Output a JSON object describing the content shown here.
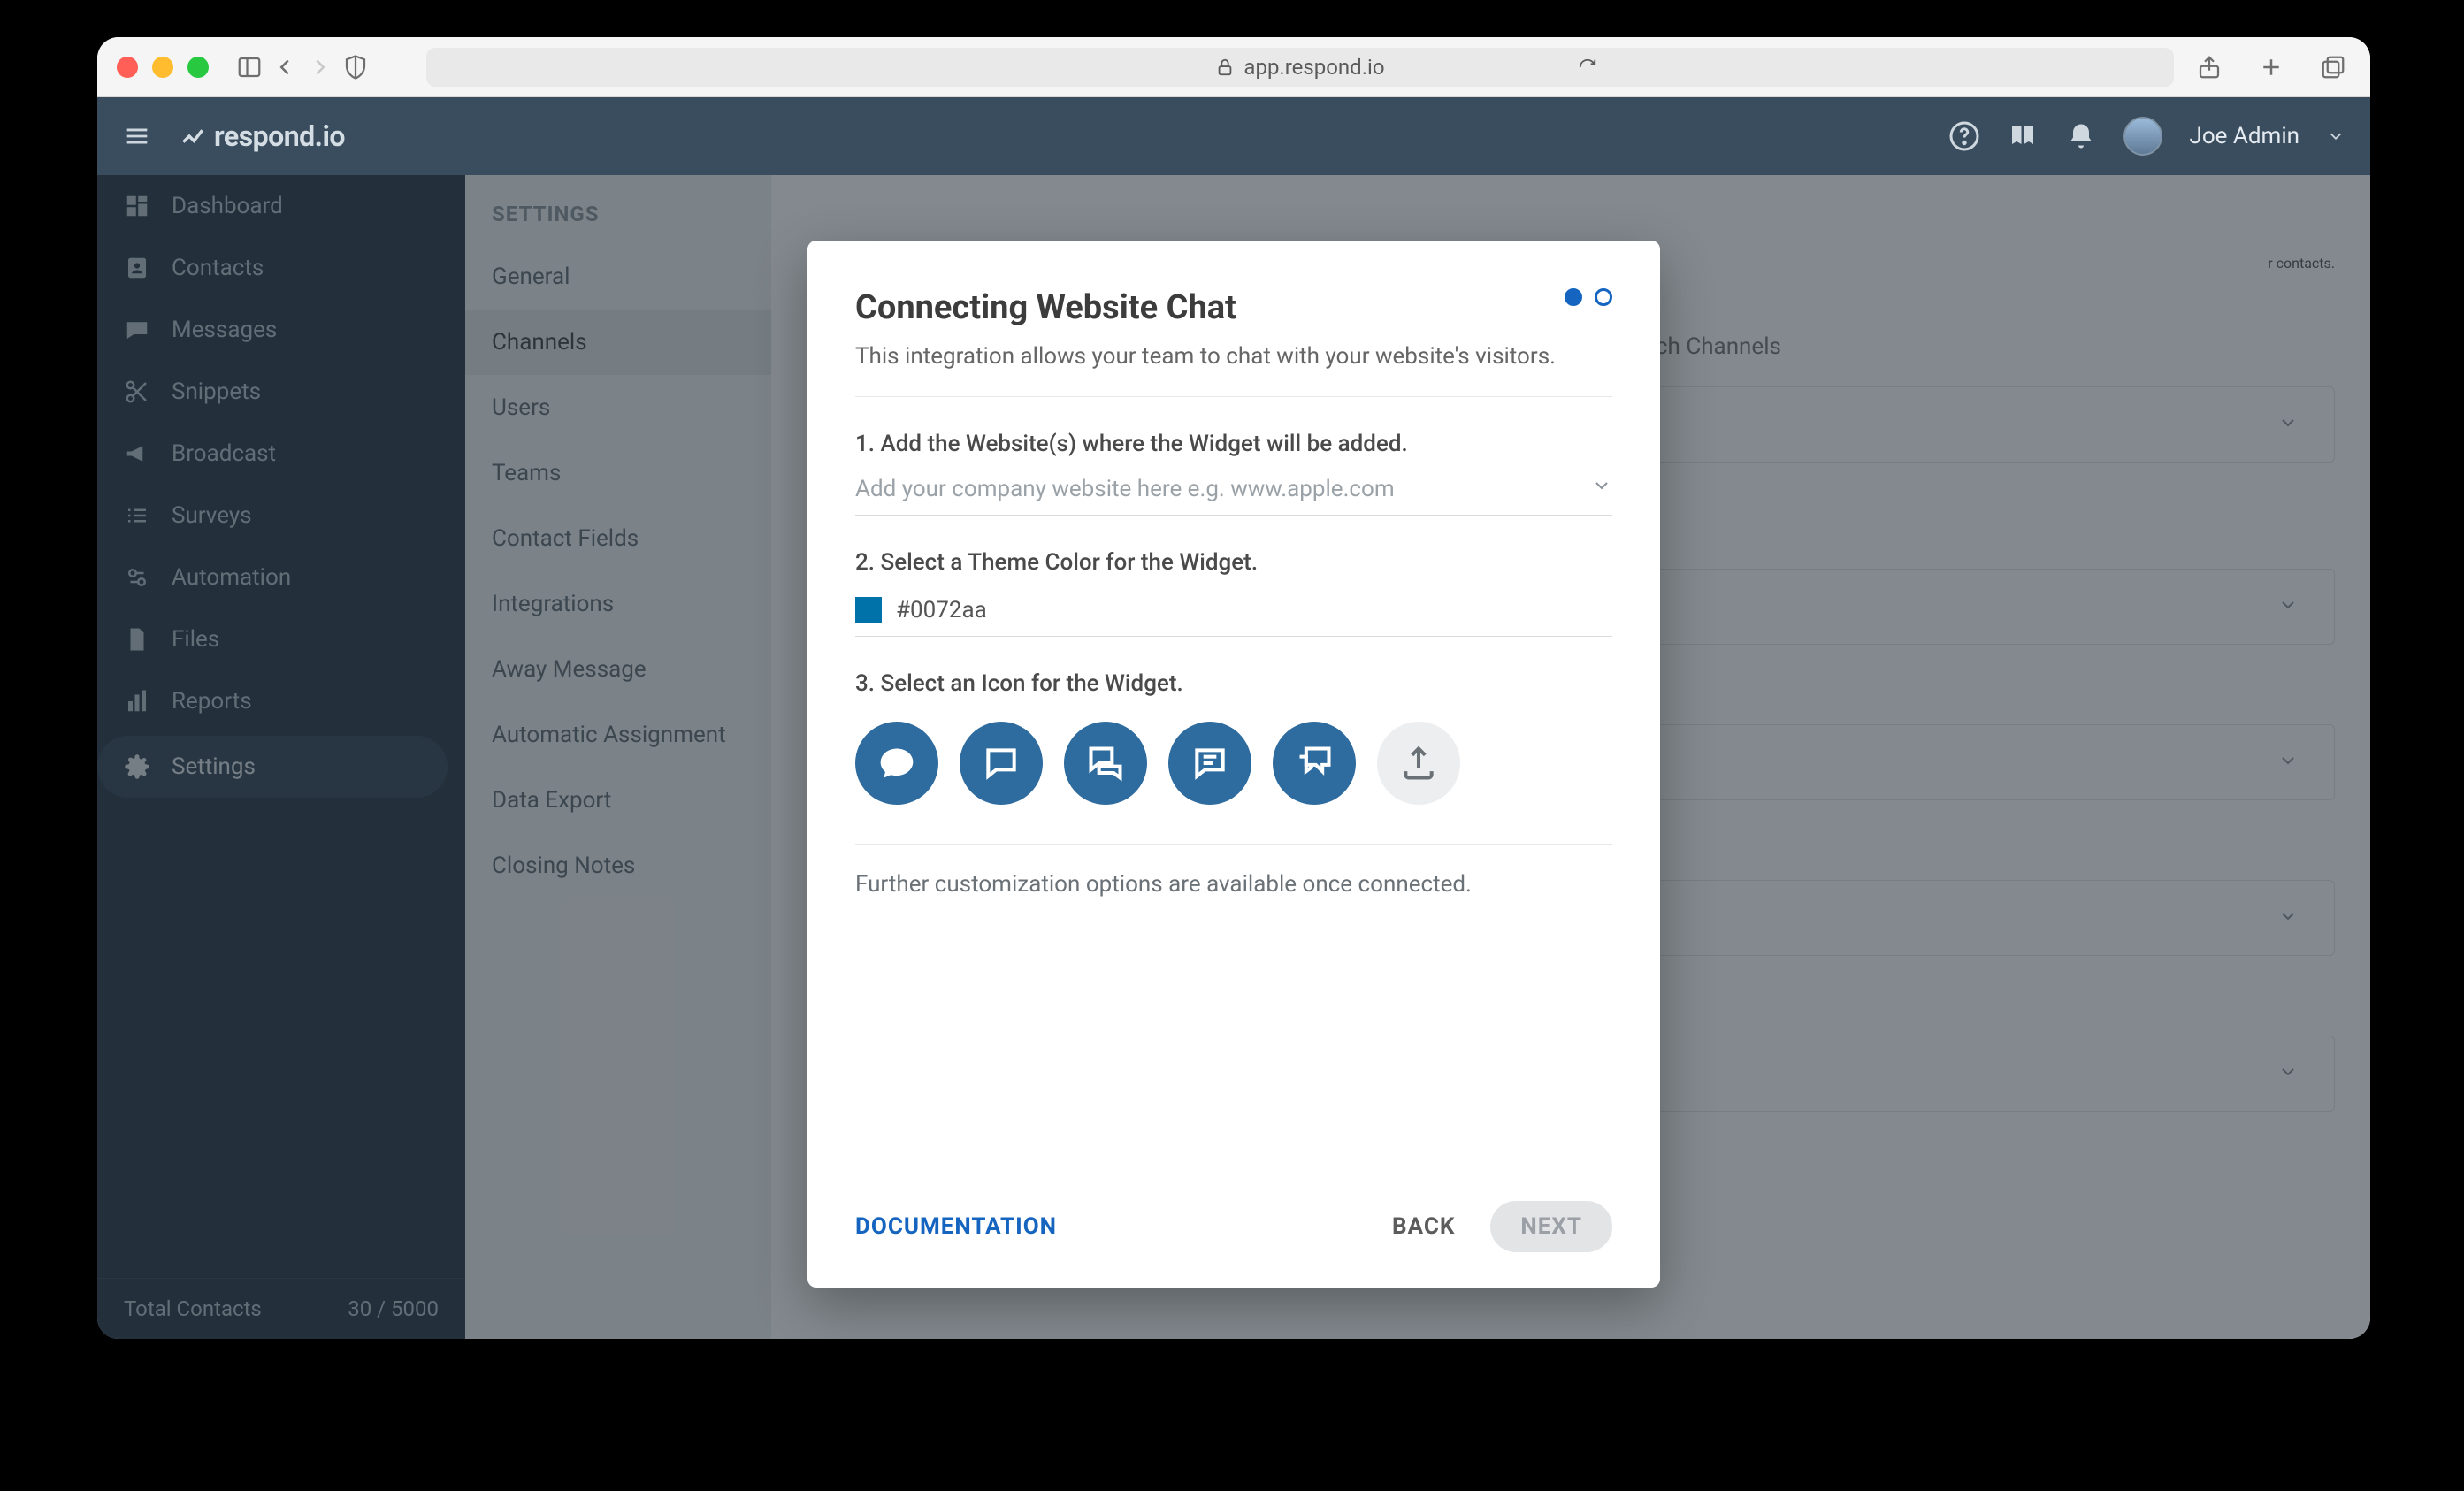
{
  "browser": {
    "url": "app.respond.io"
  },
  "header": {
    "brand": "respond.io",
    "username": "Joe Admin"
  },
  "sidebar": {
    "items": [
      {
        "icon": "dashboard",
        "label": "Dashboard"
      },
      {
        "icon": "contacts",
        "label": "Contacts"
      },
      {
        "icon": "messages",
        "label": "Messages"
      },
      {
        "icon": "snippets",
        "label": "Snippets"
      },
      {
        "icon": "broadcast",
        "label": "Broadcast"
      },
      {
        "icon": "surveys",
        "label": "Surveys"
      },
      {
        "icon": "automation",
        "label": "Automation"
      },
      {
        "icon": "files",
        "label": "Files"
      },
      {
        "icon": "reports",
        "label": "Reports"
      },
      {
        "icon": "settings",
        "label": "Settings"
      }
    ],
    "footer_label": "Total Contacts",
    "footer_value": "30 / 5000"
  },
  "settings": {
    "title": "SETTINGS",
    "items": [
      "General",
      "Channels",
      "Users",
      "Teams",
      "Contact Fields",
      "Integrations",
      "Away Message",
      "Automatic Assignment",
      "Data Export",
      "Closing Notes"
    ],
    "active_index": 1
  },
  "content": {
    "hint_suffix": "r contacts.",
    "search_placeholder": "Search Channels"
  },
  "modal": {
    "title": "Connecting Website Chat",
    "subtitle": "This integration allows your team to chat with your website's visitors.",
    "step1_label": "1. Add the Website(s) where the Widget will be added.",
    "step1_placeholder": "Add your company website here e.g. www.apple.com",
    "step2_label": "2. Select a Theme Color for the Widget.",
    "theme_color": "#0072aa",
    "step3_label": "3. Select an Icon for the Widget.",
    "further_text": "Further customization options are available once connected.",
    "documentation_label": "DOCUMENTATION",
    "back_label": "BACK",
    "next_label": "NEXT",
    "icons": [
      "chat-solid",
      "chat-outline",
      "chat-qa",
      "chat-lines",
      "chat-multi",
      "upload"
    ]
  }
}
